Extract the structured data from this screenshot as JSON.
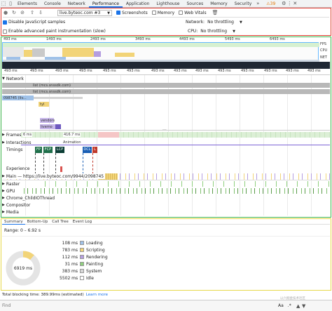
{
  "tabs": [
    "Elements",
    "Console",
    "Network",
    "Performance",
    "Application",
    "Lighthouse",
    "Sources",
    "Memory",
    "Security"
  ],
  "active_tab": "Performance",
  "badge_count": "39",
  "toolbar": {
    "url": "live.byteoc.com #3",
    "screenshots": "Screenshots",
    "memory": "Memory",
    "web_vitals": "Web Vitals"
  },
  "settings": {
    "disable_js": "Disable JavaScript samples",
    "adv_paint": "Enable advanced paint instrumentation (slow)",
    "network_label": "Network:",
    "network_value": "No throttling",
    "cpu_label": "CPU:",
    "cpu_value": "No throttling"
  },
  "overview_labels": {
    "fps": "FPS",
    "cpu": "CPU",
    "net": "NET"
  },
  "overview_ticks": [
    "493 ms",
    "1493 ms",
    "2493 ms",
    "3493 ms",
    "4493 ms",
    "5493 ms",
    "6493 ms"
  ],
  "ruler_ticks": [
    "493 ms",
    "493 ms",
    "493 ms",
    "493 ms",
    "493 ms",
    "493 ms",
    "493 ms",
    "493 ms",
    "493 ms",
    "493 ms",
    "493 ms",
    "493 ms",
    "493 ms",
    "493 ms"
  ],
  "network": {
    "title": "Network",
    "items": [
      "list (mcs.snssdk.com)",
      "list (mcs.snssdk.com)",
      "098745 (liv...",
      "tyl",
      "vendors",
      "livemo"
    ]
  },
  "tracks": {
    "frames": "Frames",
    "frames_a": "6 ms",
    "frames_b": "416.7 ms",
    "interactions": "Interactions",
    "animation": "Animation",
    "timings": "Timings",
    "markers": [
      "FP",
      "FCP",
      "LCP",
      "DCL",
      "L"
    ],
    "experience": "Experience",
    "main": "Main — https://live.byteoc.com/9944/2098745",
    "raster": "Raster",
    "gpu": "GPU",
    "child": "Chrome_ChildIOThread",
    "compositor": "Compositor",
    "media": "Media"
  },
  "bottom_tabs": [
    "Summary",
    "Bottom-Up",
    "Call Tree",
    "Event Log"
  ],
  "summary": {
    "range": "Range: 0 – 6.92 s",
    "total": "6919 ms",
    "rows": [
      {
        "ms": "108 ms",
        "label": "Loading",
        "color": "#9fc1e8"
      },
      {
        "ms": "783 ms",
        "label": "Scripting",
        "color": "#f2d478"
      },
      {
        "ms": "112 ms",
        "label": "Rendering",
        "color": "#b49de0"
      },
      {
        "ms": "31 ms",
        "label": "Painting",
        "color": "#8fcf7e"
      },
      {
        "ms": "383 ms",
        "label": "System",
        "color": "#d7d7d7"
      },
      {
        "ms": "5502 ms",
        "label": "Idle",
        "color": "#ffffff"
      }
    ]
  },
  "blocking": "Total blocking time: 389.99ms (estimated)",
  "learn_more": "Learn more",
  "find": {
    "placeholder": "Find",
    "aa": "Aa",
    ".*": ".*"
  },
  "watermark": "以六掘金技术社区"
}
